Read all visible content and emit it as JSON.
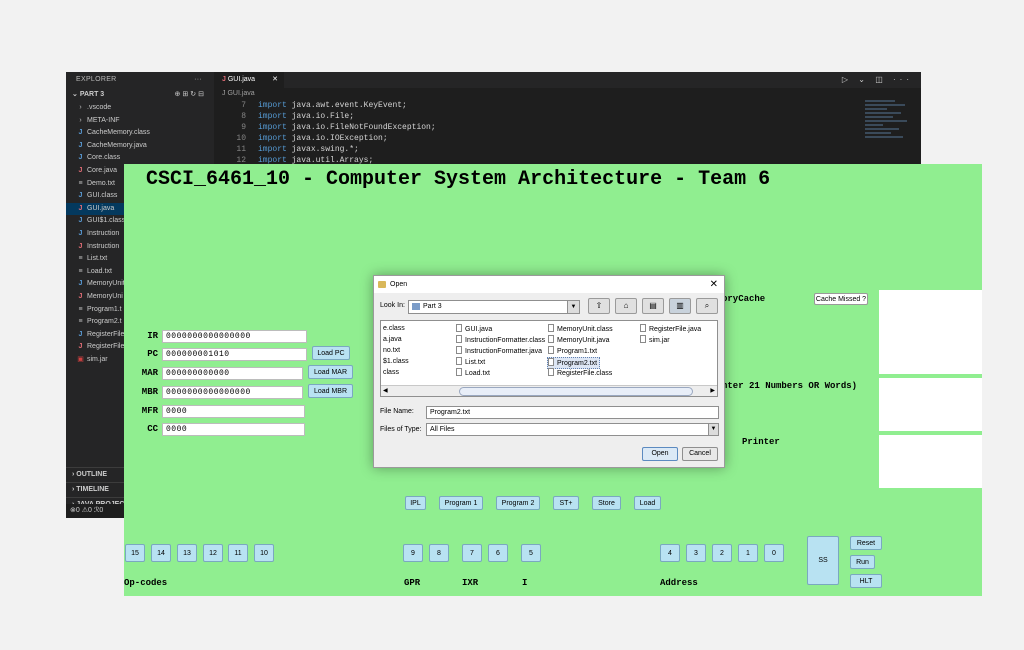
{
  "vscode": {
    "explorer_title": "EXPLORER",
    "more": "···",
    "section": "PART 3",
    "section_actions": "⊕⊞↻⊟",
    "files": [
      {
        "name": ".vscode",
        "icon": "chevron-right-icon"
      },
      {
        "name": "META-INF",
        "icon": "chevron-right-icon"
      },
      {
        "name": "CacheMemory.class",
        "icon": "java-icon"
      },
      {
        "name": "CacheMemory.java",
        "icon": "java-icon"
      },
      {
        "name": "Core.class",
        "icon": "java-icon"
      },
      {
        "name": "Core.java",
        "icon": "java-icon"
      },
      {
        "name": "Demo.txt",
        "icon": "text-file-icon"
      },
      {
        "name": "GUI.class",
        "icon": "java-icon"
      },
      {
        "name": "GUI.java",
        "icon": "java-icon"
      },
      {
        "name": "GUI$1.class",
        "icon": "java-icon"
      },
      {
        "name": "Instruction",
        "icon": "java-icon"
      },
      {
        "name": "Instruction",
        "icon": "java-icon"
      },
      {
        "name": "List.txt",
        "icon": "text-file-icon"
      },
      {
        "name": "Load.txt",
        "icon": "text-file-icon"
      },
      {
        "name": "MemoryUnit",
        "icon": "java-icon"
      },
      {
        "name": "MemoryUni",
        "icon": "java-icon"
      },
      {
        "name": "Program1.t",
        "icon": "text-file-icon"
      },
      {
        "name": "Program2.t",
        "icon": "text-file-icon"
      },
      {
        "name": "RegisterFile",
        "icon": "java-icon"
      },
      {
        "name": "RegisterFile",
        "icon": "java-icon"
      },
      {
        "name": "sim.jar",
        "icon": "jar-icon"
      }
    ],
    "bottom_sections": [
      "OUTLINE",
      "TIMELINE",
      "JAVA PROJECTS"
    ],
    "status": "⊗0 ⚠0  ℛ0",
    "tab": {
      "name": "GUI.java",
      "close": "✕"
    },
    "tab_actions": "▷ ⌄ ◫ ···",
    "breadcrumb": "J GUI.java",
    "code": [
      {
        "ln": "7",
        "text": "java.awt.event.KeyEvent;"
      },
      {
        "ln": "8",
        "text": "java.io.File;"
      },
      {
        "ln": "9",
        "text": "java.io.FileNotFoundException;"
      },
      {
        "ln": "10",
        "text": "java.io.IOException;"
      },
      {
        "ln": "11",
        "text": "javax.swing.*;"
      },
      {
        "ln": "12",
        "text": "java.util.Arrays;"
      }
    ],
    "keyword": "import"
  },
  "sim": {
    "title": "CSCI_6461_10 - Computer System Architecture - Team 6",
    "registers": {
      "ir": {
        "label": "IR",
        "value": "0000000000000000"
      },
      "pc": {
        "label": "PC",
        "value": "000000001010"
      },
      "mar": {
        "label": "MAR",
        "value": "000000000000"
      },
      "mbr": {
        "label": "MBR",
        "value": "0000000000000000"
      },
      "mfr": {
        "label": "MFR",
        "value": "0000"
      },
      "cc": {
        "label": "CC",
        "value": "0000"
      }
    },
    "load_pc": "Load PC",
    "load_mar": "Load MAR",
    "load_mbr": "Load MBR",
    "memory_cache_label": "oryCache",
    "cache_missed": "Cache Missed ?",
    "input_label": "nter 21 Numbers OR Words)",
    "printer_label": "Printer",
    "actions": [
      "IPL",
      "Program 1",
      "Program 2",
      "ST+",
      "Store",
      "Load"
    ],
    "opcode_bits": [
      "15",
      "14",
      "13",
      "12",
      "11",
      "10"
    ],
    "gpr_bits": [
      "9",
      "8"
    ],
    "ixr_bits": [
      "7",
      "6"
    ],
    "i_bit": "5",
    "address_bits": [
      "4",
      "3",
      "2",
      "1",
      "0"
    ],
    "ss": "SS",
    "reset": "Reset",
    "run": "Run",
    "hlt": "HLT",
    "labels": {
      "opcodes": "Op-codes",
      "gpr": "GPR",
      "ixr": "IXR",
      "i": "I",
      "address": "Address"
    }
  },
  "dialog": {
    "title": "Open",
    "close": "✕",
    "look_in_label": "Look In:",
    "look_in_value": "Part 3",
    "files": [
      "e.class",
      "a.java",
      "no.txt",
      "$1.class",
      "class",
      "GUI.java",
      "InstructionFormatter.class",
      "InstructionFormatter.java",
      "List.txt",
      "Load.txt",
      "MemoryUnit.class",
      "MemoryUnit.java",
      "Program1.txt",
      "Program2.txt",
      "RegisterFile.class",
      "RegisterFile.java",
      "sim.jar"
    ],
    "file_name_label": "File Name:",
    "file_name_value": "Program2.txt",
    "files_of_type_label": "Files of Type:",
    "files_of_type_value": "All Files",
    "open": "Open",
    "cancel": "Cancel"
  }
}
